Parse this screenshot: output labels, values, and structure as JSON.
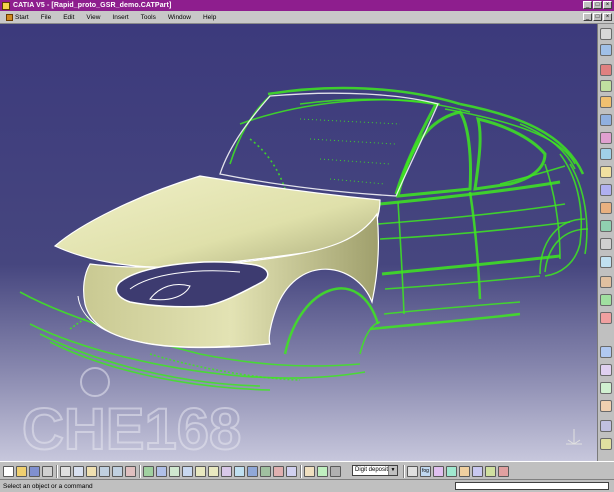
{
  "window": {
    "title": "CATIA V5 - [Rapid_proto_GSR_demo.CATPart]",
    "controls": {
      "minimize": "_",
      "maximize": "□",
      "close": "×"
    }
  },
  "menu": {
    "items": [
      {
        "label": "Start",
        "icon": "start-icon"
      },
      {
        "label": "File"
      },
      {
        "label": "Edit"
      },
      {
        "label": "View"
      },
      {
        "label": "Insert"
      },
      {
        "label": "Tools"
      },
      {
        "label": "Window"
      },
      {
        "label": "Help"
      }
    ]
  },
  "viewport": {
    "background_top": "#3c3a7c",
    "background_bottom": "#c7c7dc",
    "watermark": "CHE168",
    "wire_color": "#3ee820",
    "surface_color": "#dfe0aa"
  },
  "toolbar_bottom": {
    "view_mode_value": "Digit deposit",
    "fog_label": "fog"
  },
  "status": {
    "prompt": "Select an object or a command"
  }
}
